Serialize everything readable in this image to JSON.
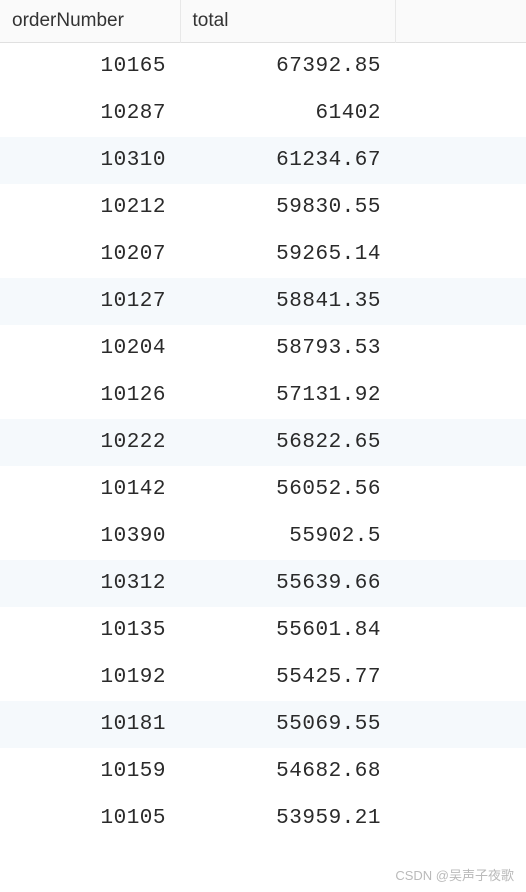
{
  "table": {
    "headers": {
      "orderNumber": "orderNumber",
      "total": "total"
    },
    "rows": [
      {
        "orderNumber": "10165",
        "total": "67392.85"
      },
      {
        "orderNumber": "10287",
        "total": "61402"
      },
      {
        "orderNumber": "10310",
        "total": "61234.67"
      },
      {
        "orderNumber": "10212",
        "total": "59830.55"
      },
      {
        "orderNumber": "10207",
        "total": "59265.14"
      },
      {
        "orderNumber": "10127",
        "total": "58841.35"
      },
      {
        "orderNumber": "10204",
        "total": "58793.53"
      },
      {
        "orderNumber": "10126",
        "total": "57131.92"
      },
      {
        "orderNumber": "10222",
        "total": "56822.65"
      },
      {
        "orderNumber": "10142",
        "total": "56052.56"
      },
      {
        "orderNumber": "10390",
        "total": "55902.5"
      },
      {
        "orderNumber": "10312",
        "total": "55639.66"
      },
      {
        "orderNumber": "10135",
        "total": "55601.84"
      },
      {
        "orderNumber": "10192",
        "total": "55425.77"
      },
      {
        "orderNumber": "10181",
        "total": "55069.55"
      },
      {
        "orderNumber": "10159",
        "total": "54682.68"
      },
      {
        "orderNumber": "10105",
        "total": "53959.21"
      }
    ]
  },
  "watermark": "CSDN @吴声子夜歌"
}
